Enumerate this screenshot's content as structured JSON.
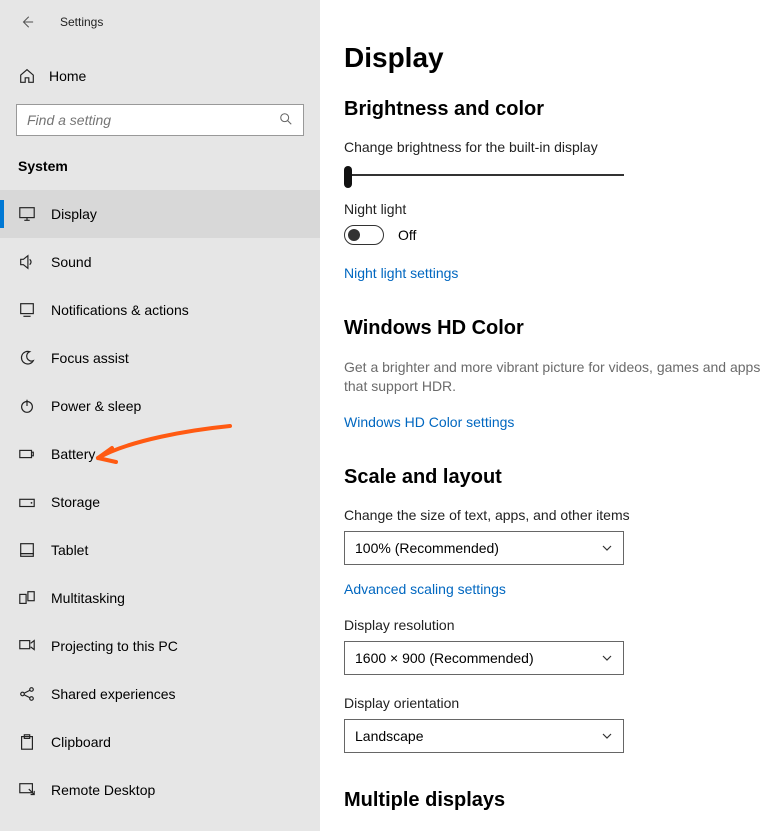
{
  "app_title": "Settings",
  "home_label": "Home",
  "search": {
    "placeholder": "Find a setting"
  },
  "sidebar_section": "System",
  "nav": [
    {
      "id": "display",
      "label": "Display",
      "selected": true,
      "icon": "monitor"
    },
    {
      "id": "sound",
      "label": "Sound",
      "selected": false,
      "icon": "speaker"
    },
    {
      "id": "notifications",
      "label": "Notifications & actions",
      "selected": false,
      "icon": "bell"
    },
    {
      "id": "focus",
      "label": "Focus assist",
      "selected": false,
      "icon": "moon"
    },
    {
      "id": "power",
      "label": "Power & sleep",
      "selected": false,
      "icon": "power"
    },
    {
      "id": "battery",
      "label": "Battery",
      "selected": false,
      "icon": "battery"
    },
    {
      "id": "storage",
      "label": "Storage",
      "selected": false,
      "icon": "drive"
    },
    {
      "id": "tablet",
      "label": "Tablet",
      "selected": false,
      "icon": "tablet"
    },
    {
      "id": "multitasking",
      "label": "Multitasking",
      "selected": false,
      "icon": "multitask"
    },
    {
      "id": "projecting",
      "label": "Projecting to this PC",
      "selected": false,
      "icon": "project"
    },
    {
      "id": "shared",
      "label": "Shared experiences",
      "selected": false,
      "icon": "share"
    },
    {
      "id": "clipboard",
      "label": "Clipboard",
      "selected": false,
      "icon": "clipboard"
    },
    {
      "id": "remote",
      "label": "Remote Desktop",
      "selected": false,
      "icon": "remote"
    }
  ],
  "content": {
    "page_title": "Display",
    "brightness": {
      "section": "Brightness and color",
      "label": "Change brightness for the built-in display",
      "night_light_label": "Night light",
      "night_light_state": "Off",
      "night_light_link": "Night light settings"
    },
    "hd": {
      "section": "Windows HD Color",
      "desc": "Get a brighter and more vibrant picture for videos, games and apps that support HDR.",
      "link": "Windows HD Color settings"
    },
    "scale": {
      "section": "Scale and layout",
      "size_label": "Change the size of text, apps, and other items",
      "size_value": "100% (Recommended)",
      "adv_link": "Advanced scaling settings",
      "res_label": "Display resolution",
      "res_value": "1600 × 900 (Recommended)",
      "orient_label": "Display orientation",
      "orient_value": "Landscape"
    },
    "multi": {
      "section": "Multiple displays"
    }
  }
}
